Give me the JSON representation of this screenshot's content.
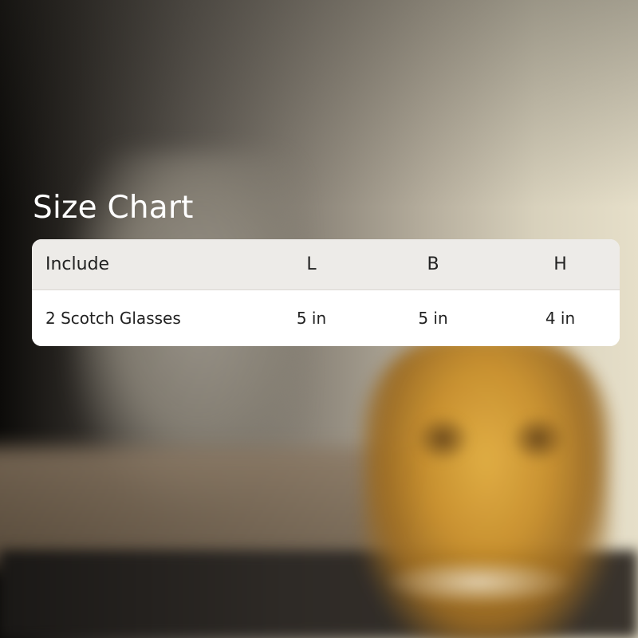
{
  "title": "Size Chart",
  "size_table": {
    "headers": [
      "Include",
      "L",
      "B",
      "H"
    ],
    "rows": [
      [
        "2 Scotch Glasses",
        "5 in",
        "5 in",
        "4 in"
      ]
    ]
  }
}
